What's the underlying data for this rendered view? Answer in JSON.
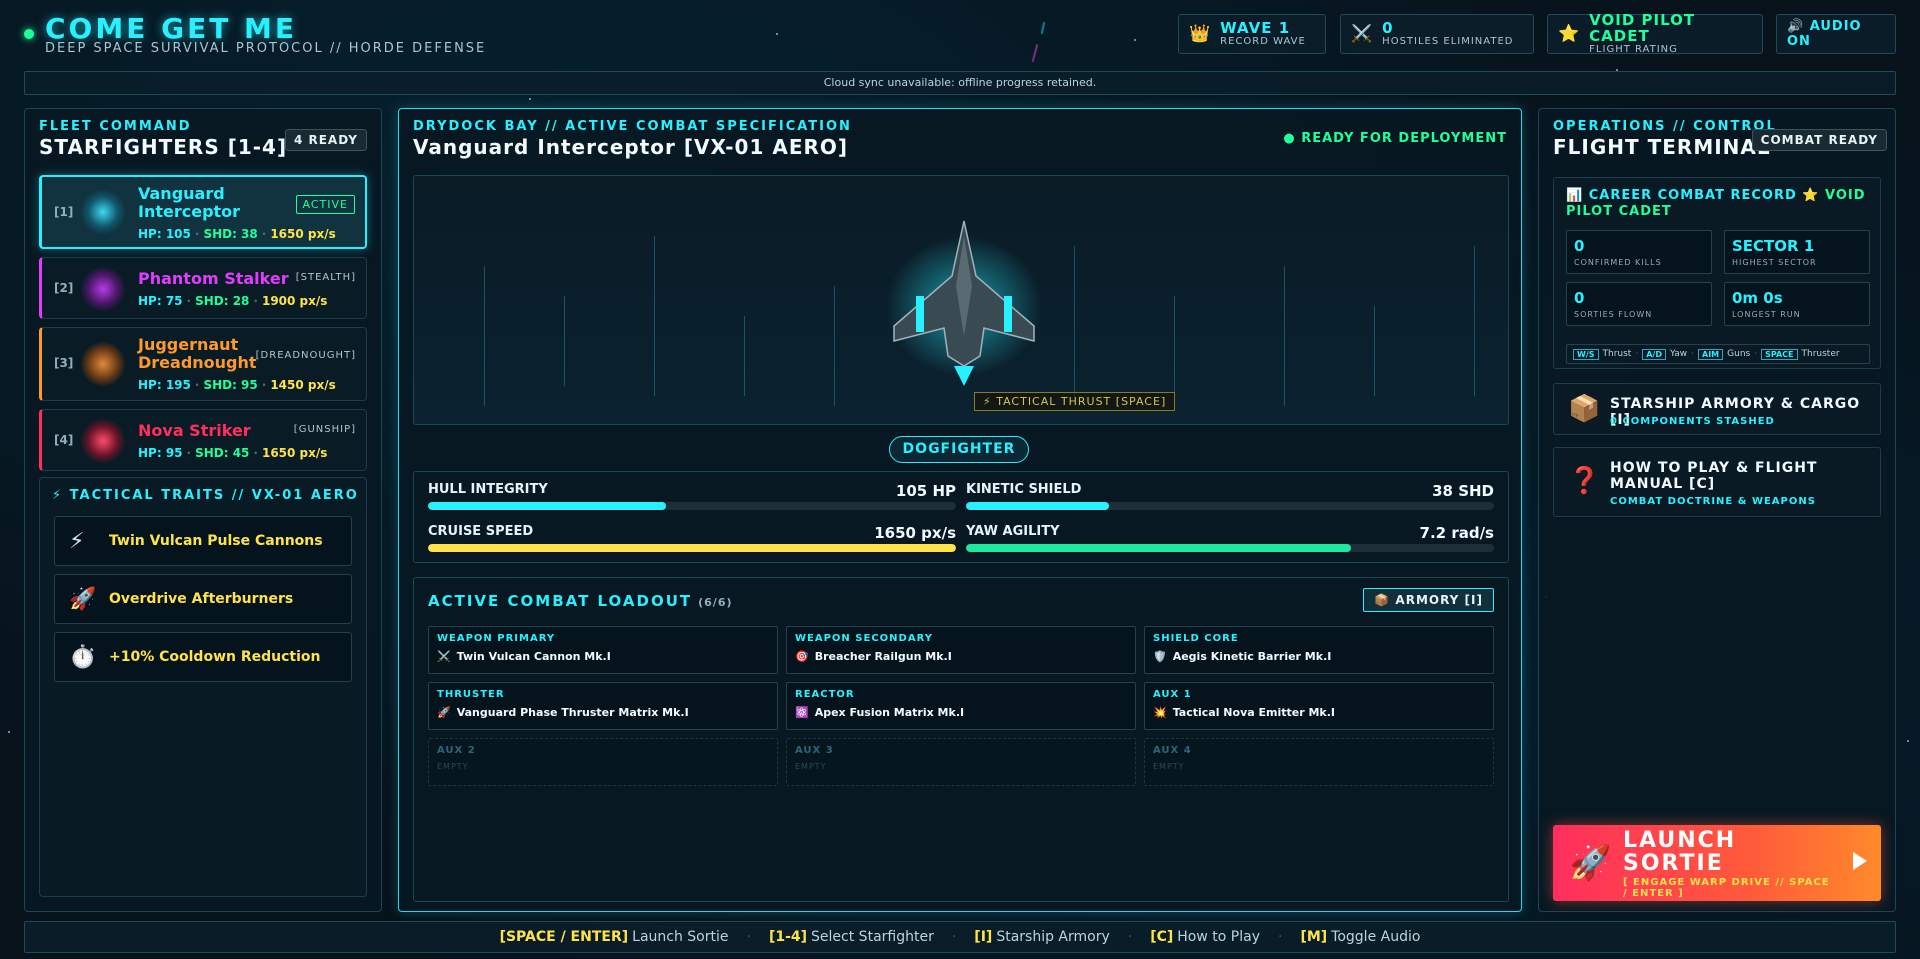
{
  "header": {
    "title": "COME GET ME",
    "subtitle": "DEEP SPACE SURVIVAL PROTOCOL // HORDE DEFENSE",
    "wave": {
      "value": "WAVE 1",
      "label": "RECORD WAVE",
      "icon": "crown-icon"
    },
    "kills": {
      "value": "0",
      "label": "HOSTILES ELIMINATED",
      "icon": "crossed-swords-icon"
    },
    "rank": {
      "value": "VOID PILOT CADET",
      "label": "FLIGHT RATING",
      "icon": "star-icon"
    },
    "audio": "🔊 AUDIO ON"
  },
  "cloud_notice": "Cloud sync unavailable: offline progress retained.",
  "fleet": {
    "tag": "FLEET COMMAND",
    "title": "STARFIGHTERS [1-4]",
    "ready_chip": "4 READY",
    "ships": [
      {
        "num": "[1]",
        "name": "Vanguard Interceptor",
        "tag": "ACTIVE",
        "hp": "HP: 105",
        "shd": "SHD: 38",
        "spd": "1650 px/s",
        "color": "#29f0ff"
      },
      {
        "num": "[2]",
        "name": "Phantom Stalker",
        "tag": "[STEALTH]",
        "hp": "HP: 75",
        "shd": "SHD: 28",
        "spd": "1900 px/s",
        "color": "#e23cff"
      },
      {
        "num": "[3]",
        "name": "Juggernaut Dreadnought",
        "tag": "[DREADNOUGHT]",
        "hp": "HP: 195",
        "shd": "SHD: 95",
        "spd": "1450 px/s",
        "color": "#ff9a2a"
      },
      {
        "num": "[4]",
        "name": "Nova Striker",
        "tag": "[GUNSHIP]",
        "hp": "HP: 95",
        "shd": "SHD: 45",
        "spd": "1650 px/s",
        "color": "#ff2e5e"
      }
    ],
    "traits_title": "⚡ TACTICAL TRAITS // VX-01 AERO",
    "traits": [
      {
        "icon": "⚡",
        "label": "Twin Vulcan Pulse Cannons"
      },
      {
        "icon": "🚀",
        "label": "Overdrive Afterburners"
      },
      {
        "icon": "⏱️",
        "label": "+10% Cooldown Reduction"
      }
    ]
  },
  "drydock": {
    "tag": "DRYDOCK BAY // ACTIVE COMBAT SPECIFICATION",
    "title": "Vanguard Interceptor [VX-01 AERO]",
    "status": "● READY FOR DEPLOYMENT",
    "thrust_tag": "⚡ TACTICAL THRUST [SPACE]",
    "class": "DOGFIGHTER",
    "stats": [
      {
        "label": "HULL INTEGRITY",
        "value": "105 HP",
        "pct": 45,
        "color": "#29f0ff"
      },
      {
        "label": "KINETIC SHIELD",
        "value": "38 SHD",
        "pct": 27,
        "color": "#29f0ff"
      },
      {
        "label": "CRUISE SPEED",
        "value": "1650 px/s",
        "pct": 100,
        "color": "#ffe34a"
      },
      {
        "label": "YAW AGILITY",
        "value": "7.2 rad/s",
        "pct": 73,
        "color": "#1fe8a0"
      }
    ],
    "loadout_title": "ACTIVE COMBAT LOADOUT",
    "loadout_count": "(6/6)",
    "armory_button": "📦 ARMORY [I]",
    "slots": [
      {
        "label": "WEAPON PRIMARY",
        "icon": "⚔️",
        "value": "Twin Vulcan Cannon Mk.I"
      },
      {
        "label": "WEAPON SECONDARY",
        "icon": "🎯",
        "value": "Breacher Railgun Mk.I"
      },
      {
        "label": "SHIELD CORE",
        "icon": "🛡️",
        "value": "Aegis Kinetic Barrier Mk.I"
      },
      {
        "label": "THRUSTER",
        "icon": "🚀",
        "value": "Vanguard Phase Thruster Matrix Mk.I"
      },
      {
        "label": "REACTOR",
        "icon": "⚛️",
        "value": "Apex Fusion Matrix Mk.I"
      },
      {
        "label": "AUX 1",
        "icon": "💥",
        "value": "Tactical Nova Emitter Mk.I"
      },
      {
        "label": "AUX 2",
        "icon": "",
        "value": "EMPTY"
      },
      {
        "label": "AUX 3",
        "icon": "",
        "value": "EMPTY"
      },
      {
        "label": "AUX 4",
        "icon": "",
        "value": "EMPTY"
      }
    ]
  },
  "ops": {
    "tag": "OPERATIONS // CONTROL",
    "title": "FLIGHT TERMINAL",
    "chip": "COMBAT READY",
    "career_title": "📊 CAREER COMBAT RECORD",
    "career_rank": "⭐ VOID PILOT CADET",
    "career": [
      {
        "value": "0",
        "label": "CONFIRMED KILLS"
      },
      {
        "value": "SECTOR 1",
        "label": "HIGHEST SECTOR"
      },
      {
        "value": "0",
        "label": "SORTIES FLOWN"
      },
      {
        "value": "0m 0s",
        "label": "LONGEST RUN"
      }
    ],
    "keys": [
      {
        "k": "W/S",
        "d": "Thrust"
      },
      {
        "k": "A/D",
        "d": "Yaw"
      },
      {
        "k": "AIM",
        "d": "Guns"
      },
      {
        "k": "SPACE",
        "d": "Thruster"
      }
    ],
    "armory": {
      "icon": "📦",
      "title": "STARSHIP ARMORY & CARGO [I]",
      "sub": "0 COMPONENTS STASHED"
    },
    "manual": {
      "icon": "❓",
      "title": "HOW TO PLAY & FLIGHT MANUAL [C]",
      "sub": "COMBAT DOCTRINE & WEAPONS"
    },
    "launch": {
      "icon": "🚀",
      "title": "LAUNCH SORTIE",
      "sub": "[ ENGAGE WARP DRIVE // SPACE / ENTER ]"
    }
  },
  "footer": [
    {
      "key": "[SPACE / ENTER]",
      "desc": "Launch Sortie"
    },
    {
      "key": "[1-4]",
      "desc": "Select Starfighter"
    },
    {
      "key": "[I]",
      "desc": "Starship Armory"
    },
    {
      "key": "[C]",
      "desc": "How to Play"
    },
    {
      "key": "[M]",
      "desc": "Toggle Audio"
    }
  ]
}
